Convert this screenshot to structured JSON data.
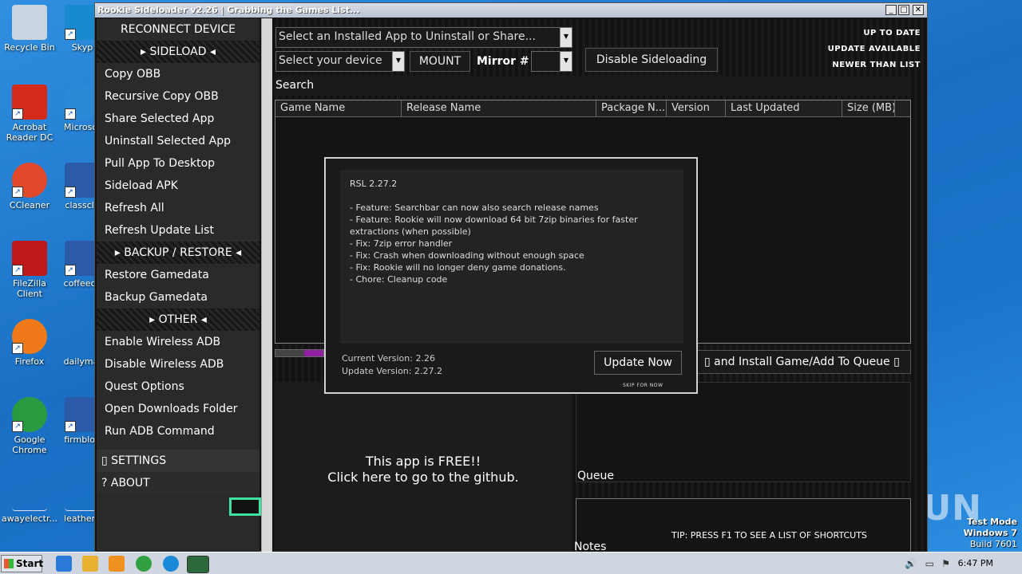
{
  "desktop": {
    "icons": [
      {
        "label": "Recycle Bin",
        "icon": "recycle-bin-icon",
        "color": "#c8d4e0"
      },
      {
        "label": "Acrobat Reader DC",
        "icon": "acrobat-icon",
        "color": "#d42a1a"
      },
      {
        "label": "CCleaner",
        "icon": "ccleaner-icon",
        "color": "#e04a2a"
      },
      {
        "label": "FileZilla Client",
        "icon": "filezilla-icon",
        "color": "#c01818"
      },
      {
        "label": "Firefox",
        "icon": "firefox-icon",
        "color": "#f07a1a"
      },
      {
        "label": "Google Chrome",
        "icon": "chrome-icon",
        "color": "#2a9a40"
      },
      {
        "label": "awayelectr...",
        "icon": "document-icon",
        "color": "#f0f0f0"
      },
      {
        "label": "Skyp",
        "icon": "skype-icon",
        "color": "#1a8ad0"
      },
      {
        "label": "Microsof",
        "icon": "edge-icon",
        "color": "#2a8ad8"
      },
      {
        "label": "classclo",
        "icon": "word-icon",
        "color": "#2a5aa8"
      },
      {
        "label": "coffeeca",
        "icon": "word-icon",
        "color": "#2a5aa8"
      },
      {
        "label": "dailymal",
        "icon": "document-icon",
        "color": "#f0f0f0"
      },
      {
        "label": "firmbloo",
        "icon": "word-icon",
        "color": "#2a5aa8"
      },
      {
        "label": "leathern",
        "icon": "document-icon",
        "color": "#f0f0f0"
      }
    ],
    "watermark": "ANY RUN",
    "testmode": {
      "line1": "Test Mode",
      "line2": "Windows 7",
      "line3": "Build 7601"
    }
  },
  "window": {
    "title": "Rookie Sideloader v2.26 | Grabbing the Games List...",
    "buttons": {
      "minimize": "_",
      "maximize": "□",
      "close": "✕"
    }
  },
  "sidebar": {
    "reconnect": "RECONNECT DEVICE",
    "sideload_head": "▸ SIDELOAD ◂",
    "sideload_items": [
      "Copy OBB",
      "Recursive Copy OBB",
      "Share Selected App",
      "Uninstall Selected App",
      "Pull App To Desktop",
      "Sideload APK",
      "Refresh All",
      "Refresh Update List"
    ],
    "backup_head": "▸ BACKUP / RESTORE ◂",
    "backup_items": [
      "Restore Gamedata",
      "Backup Gamedata"
    ],
    "other_head": "▸ OTHER ◂",
    "other_items": [
      "Enable  Wireless ADB",
      "Disable Wireless ADB",
      "Quest Options",
      "Open Downloads Folder",
      "Run ADB Command"
    ],
    "settings": "▯ SETTINGS",
    "about": "?   ABOUT"
  },
  "toolbar": {
    "installed_app_select": "Select an Installed App to Uninstall or Share...",
    "device_select": "Select your device",
    "mount": "MOUNT",
    "mirror_label": "Mirror #",
    "mirror_value": "",
    "disable_sideloading": "Disable Sideloading",
    "status_up_to_date": "UP TO DATE",
    "status_update_available": "UPDATE AVAILABLE",
    "status_newer": "NEWER THAN LIST"
  },
  "search": {
    "label": "Search"
  },
  "grid": {
    "columns": [
      "Game Name",
      "Release Name",
      "Package N...",
      "Version",
      "Last Updated",
      "Size (MB)"
    ]
  },
  "progress": {
    "fraction": 0.4
  },
  "install_button": "▯ and Install Game/Add To Queue ▯",
  "free_panel": {
    "line1": "This app is FREE!!",
    "line2": "Click here to go to the github."
  },
  "queue_label": "Queue",
  "tip": "TIP: PRESS F1 TO SEE A LIST OF SHORTCUTS",
  "notes_label": "Notes",
  "dialog": {
    "changelog": "RSL 2.27.2\n\n- Feature: Searchbar can now also search release names\n- Feature: Rookie will now download 64 bit 7zip binaries for faster extractions (when possible)\n- Fix: 7zip error handler\n- Fix: Crash when downloading without enough space\n- Fix: Rookie will no longer deny game donations.\n- Chore: Cleanup code",
    "current_version": "Current Version: 2.26",
    "update_version": "Update Version: 2.27.2",
    "update_button": "Update Now",
    "skip": "SKIP FOR NOW"
  },
  "taskbar": {
    "start": "Start",
    "clock": "6:47 PM",
    "apps": [
      {
        "icon": "ie-icon",
        "color": "#2a7ad8"
      },
      {
        "icon": "explorer-icon",
        "color": "#e8b030"
      },
      {
        "icon": "media-player-icon",
        "color": "#f09020"
      },
      {
        "icon": "chrome-icon",
        "color": "#30a040"
      },
      {
        "icon": "edge-icon",
        "color": "#1a8ad8"
      },
      {
        "icon": "rookie-icon",
        "color": "#2a6a3a"
      }
    ]
  }
}
